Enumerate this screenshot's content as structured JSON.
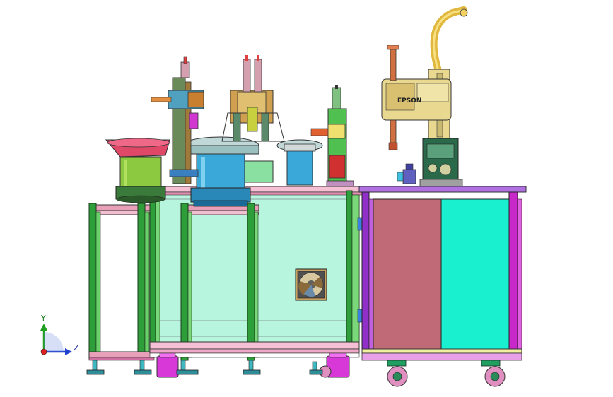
{
  "robot": {
    "brand": "EPSON"
  },
  "triad": {
    "y_label": "Y",
    "z_label": "Z"
  },
  "colors": {
    "background": "#ffffff",
    "frame_green": "#2e9e3a",
    "panel_mint": "#b8f5de",
    "panel_rose": "#c06a78",
    "panel_cyan": "#18f0d0",
    "frame_magenta": "#c828c8",
    "bowl_red": "#e04868",
    "bowl_green": "#8cc840",
    "hopper_blue": "#3aa8d8",
    "robot_yellow": "#e8d890",
    "tube_gold": "#e0b840",
    "caster_pink": "#e090c0"
  }
}
